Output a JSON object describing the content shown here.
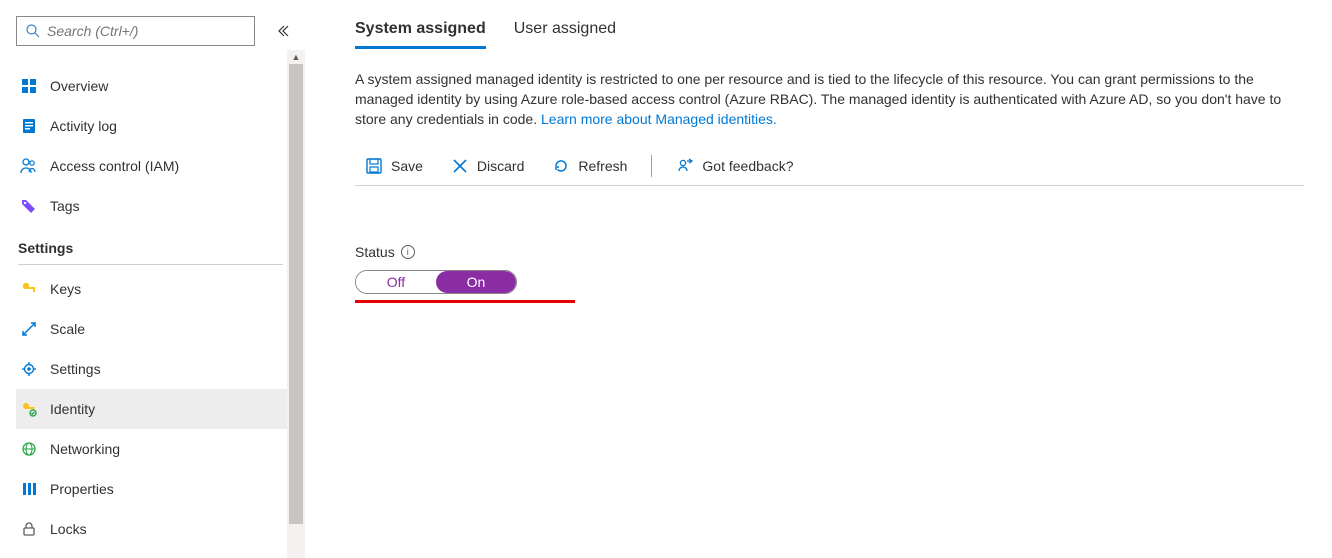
{
  "sidebar": {
    "search_placeholder": "Search (Ctrl+/)",
    "items_top": [
      {
        "label": "Overview",
        "icon": "overview"
      },
      {
        "label": "Activity log",
        "icon": "activity-log"
      },
      {
        "label": "Access control (IAM)",
        "icon": "access-control"
      },
      {
        "label": "Tags",
        "icon": "tags"
      }
    ],
    "section_label": "Settings",
    "items_settings": [
      {
        "label": "Keys",
        "icon": "keys"
      },
      {
        "label": "Scale",
        "icon": "scale"
      },
      {
        "label": "Settings",
        "icon": "settings-gear"
      },
      {
        "label": "Identity",
        "icon": "identity",
        "selected": true
      },
      {
        "label": "Networking",
        "icon": "networking"
      },
      {
        "label": "Properties",
        "icon": "properties"
      },
      {
        "label": "Locks",
        "icon": "locks"
      }
    ]
  },
  "main": {
    "tabs": [
      {
        "label": "System assigned",
        "active": true
      },
      {
        "label": "User assigned",
        "active": false
      }
    ],
    "description_pre": "A system assigned managed identity is restricted to one per resource and is tied to the lifecycle of this resource. You can grant permissions to the managed identity by using Azure role-based access control (Azure RBAC). The managed identity is authenticated with Azure AD, so you don't have to store any credentials in code. ",
    "description_link": "Learn more about Managed identities.",
    "commands": {
      "save": "Save",
      "discard": "Discard",
      "refresh": "Refresh",
      "feedback": "Got feedback?"
    },
    "status": {
      "label": "Status",
      "off": "Off",
      "on": "On",
      "value": "On"
    }
  }
}
